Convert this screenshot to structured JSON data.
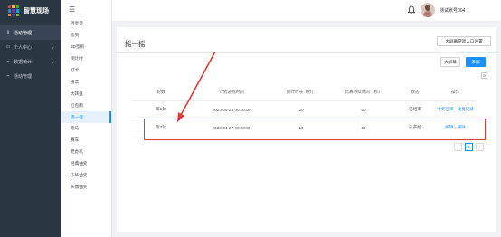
{
  "app": {
    "title": "智慧现场",
    "logo_colors": [
      "#e53935",
      "#ffb300",
      "#43a047",
      "#1e88e5",
      "#8e24aa",
      "#00acc1",
      "#fb8c00",
      "#3949ab",
      "#7cb342"
    ]
  },
  "sidebar": {
    "items": [
      {
        "label": "活动管理",
        "icon": "doc-icon",
        "active": true
      },
      {
        "label": "个人中心",
        "icon": "user-icon",
        "caret": "∨"
      },
      {
        "label": "数据统计",
        "icon": "chart-icon",
        "caret": "∨"
      },
      {
        "label": "活动管理",
        "icon": "chart-icon"
      }
    ]
  },
  "subnav": {
    "toggle_icon": "☰",
    "items": [
      {
        "label": "消息墙"
      },
      {
        "label": "签到"
      },
      {
        "label": "3D签到"
      },
      {
        "label": "倒计时"
      },
      {
        "label": "打卡"
      },
      {
        "label": "投票"
      },
      {
        "label": "大转盘"
      },
      {
        "label": "红包雨"
      },
      {
        "label": "摇一摇",
        "active": true
      },
      {
        "label": "跑马"
      },
      {
        "label": "赛车"
      },
      {
        "label": "老虎机"
      },
      {
        "label": "经典抽奖"
      },
      {
        "label": "乐华抽奖"
      },
      {
        "label": "头像抽奖"
      }
    ]
  },
  "topbar": {
    "account": "测试账号004"
  },
  "page": {
    "title": "摇一摇",
    "entry_button": "大屏幕游戏入口设置",
    "bigscreen_button": "大屏幕",
    "add_button": "添加",
    "refresh_icon": "⟳"
  },
  "table": {
    "headers": [
      "轮数",
      "计划游戏时间",
      "倒计时长（秒）",
      "比赛持续时间（秒）",
      "状态",
      "操作"
    ],
    "rows": [
      {
        "cells": [
          "第1轮",
          "2023-04-23 00:00:00",
          "10",
          "60",
          "已结束"
        ],
        "actions": [
          "中奖名单",
          "比赛记录"
        ]
      },
      {
        "cells": [
          "第2轮",
          "2023-04-27 00:00:00",
          "10",
          "60",
          "未开始"
        ],
        "actions": [
          "编辑",
          "删除"
        ]
      }
    ]
  },
  "pagination": {
    "prev": "‹",
    "current": "1",
    "next": "›"
  },
  "annotation": {
    "color": "#e53935"
  }
}
